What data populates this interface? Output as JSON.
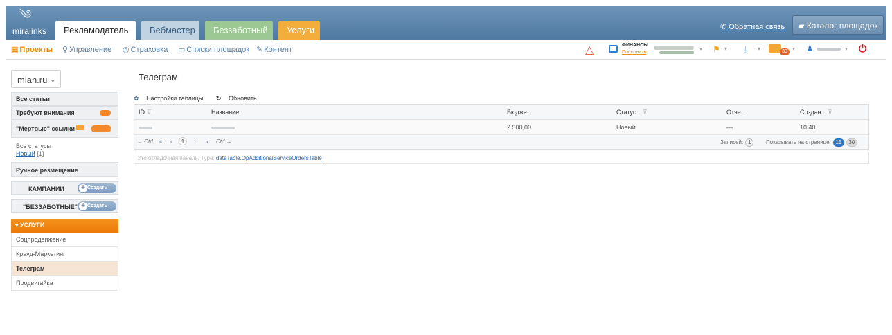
{
  "header": {
    "logo_text": "miralinks",
    "tabs": [
      {
        "label": "Рекламодатель"
      },
      {
        "label": "Вебмастер"
      },
      {
        "label": "Беззаботный"
      },
      {
        "label": "Услуги"
      }
    ],
    "feedback_label": "Обратная связь",
    "catalog_label": "Каталог площадок"
  },
  "nav": {
    "items": [
      {
        "label": "Проекты"
      },
      {
        "label": "Управление"
      },
      {
        "label": "Страховка"
      },
      {
        "label": "Списки площадок"
      },
      {
        "label": "Контент"
      }
    ],
    "finance_title": "ФИНАНСЫ",
    "finance_link": "Пополнить",
    "mail_count": "39"
  },
  "sidebar": {
    "site": "mian.ru",
    "all_articles": "Все статьи",
    "need_attention": "Требуют внимания",
    "dead_links": "\"Мертвые\" ссылки",
    "all_statuses": "Все статусы",
    "status_new": "Новый",
    "status_new_count": "[1]",
    "manual": "Ручное размещение",
    "campaigns": "КАМПАНИИ",
    "carefree": "\"БЕЗЗАБОТНЫЕ\"",
    "create_label": "Создать",
    "services_label": "▾ УСЛУГИ",
    "service_items": [
      {
        "label": "Соцпродвижение"
      },
      {
        "label": "Крауд-Маркетинг"
      },
      {
        "label": "Телеграм"
      },
      {
        "label": "Продвигайка"
      }
    ]
  },
  "main": {
    "title": "Телеграм",
    "table_settings": "Настройки таблицы",
    "refresh": "Обновить",
    "columns": {
      "id": "ID",
      "name": "Название",
      "budget": "Бюджет",
      "status": "Статус",
      "report": "Отчет",
      "created": "Создан"
    },
    "row": {
      "budget": "2 500,00",
      "status": "Новый",
      "report": "—",
      "created": "10:40"
    },
    "pager": {
      "prev_hint": "← Ctrl",
      "first": "«",
      "prev": "‹",
      "page": "1",
      "next": "›",
      "last": "»",
      "next_hint": "Ctrl →",
      "records_label": "Записей:",
      "records_count": "1",
      "per_page_label": "Показывать на странице:",
      "per_page_a": "15",
      "per_page_b": "30"
    },
    "debug_label": "Это отладочная панель. Type:",
    "debug_type": "dataTable.OpAdditionalServiceOrdersTable"
  }
}
